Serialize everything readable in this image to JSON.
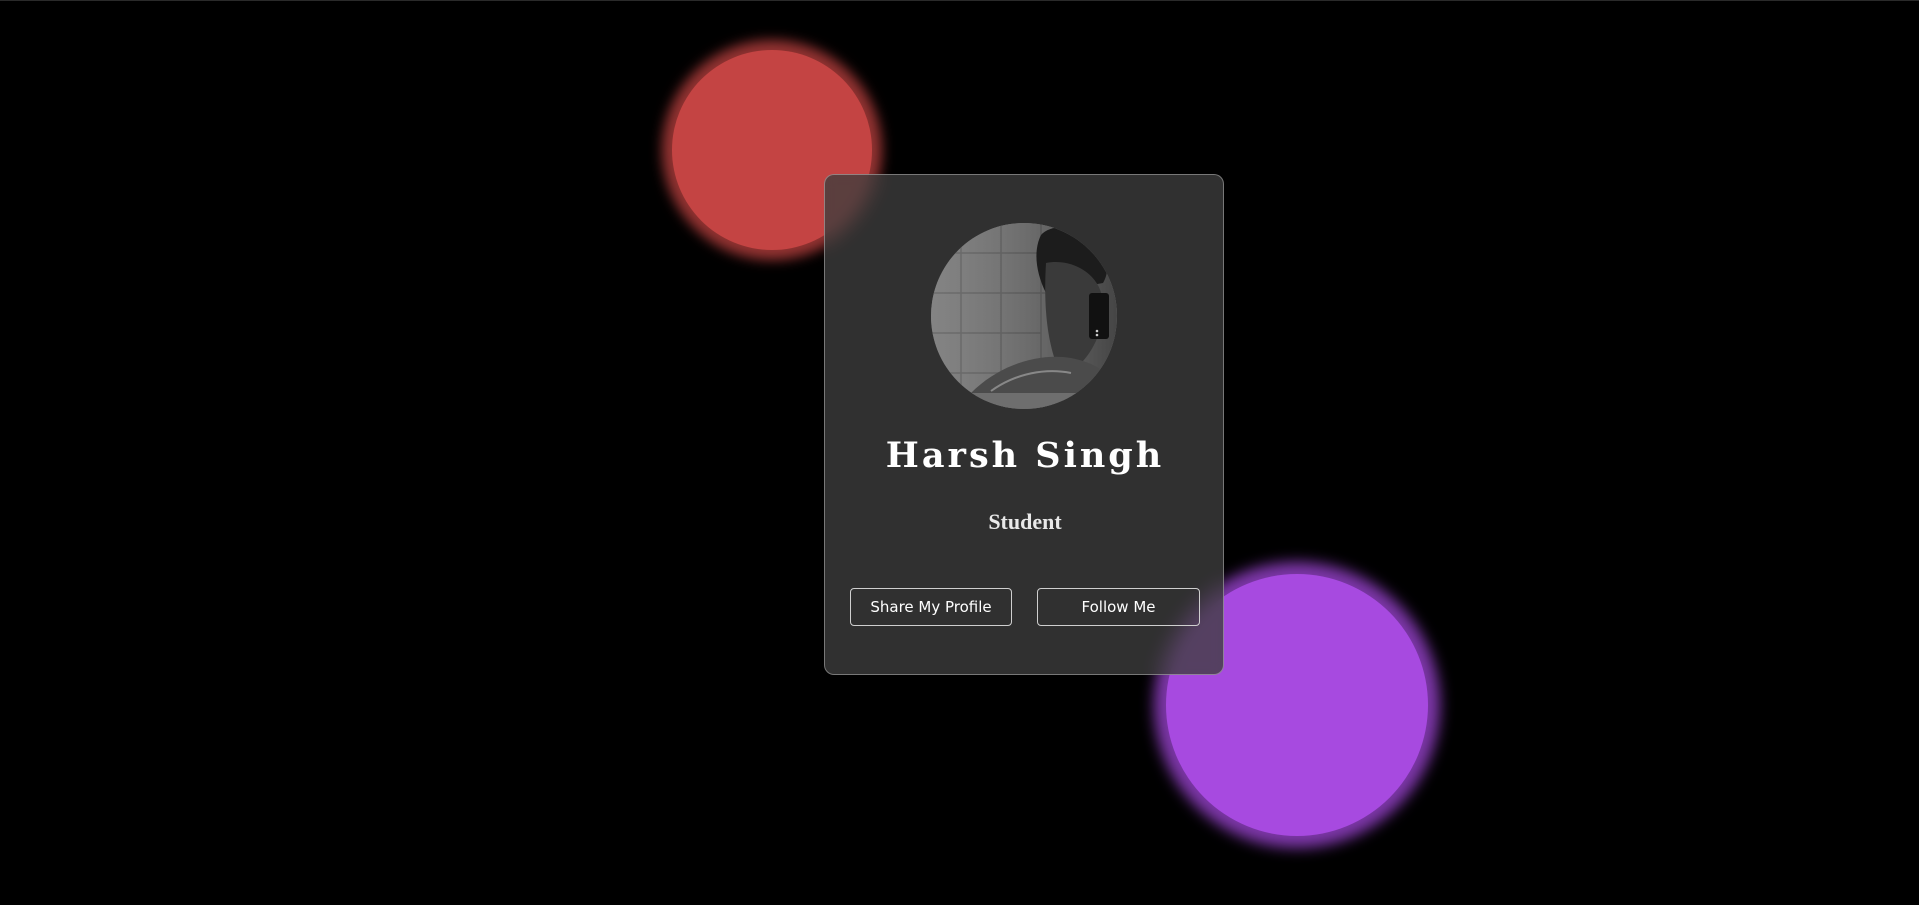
{
  "profile": {
    "name": "Harsh Singh",
    "role": "Student",
    "avatar_icon": "profile-photo"
  },
  "actions": {
    "share_label": "Share My Profile",
    "follow_label": "Follow Me"
  },
  "colors": {
    "background": "#000000",
    "card": "#3e3e3e",
    "blob_red": "#c44443",
    "blob_purple": "#a74ae0",
    "text": "#ffffff"
  }
}
